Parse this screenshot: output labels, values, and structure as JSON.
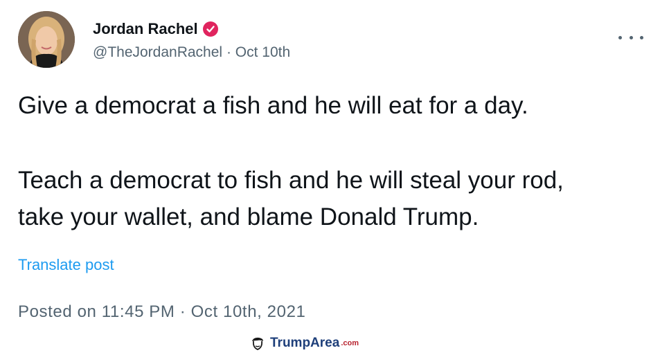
{
  "author": {
    "display_name": "Jordan Rachel",
    "handle": "@TheJordanRachel",
    "separator": "·",
    "date": "Oct 10th",
    "verified_icon": "verified-badge-icon",
    "verified_color": "#e0245e"
  },
  "menu": {
    "more_icon": "more-options-icon"
  },
  "tweet": {
    "line1": "Give a democrat a fish and he will eat for a day.",
    "line2": "Teach a democrat to fish and he will steal your rod,",
    "line3": "take your wallet, and blame Donald Trump."
  },
  "translate_label": "Translate post",
  "posted": "Posted on 11:45 PM · Oct 10th, 2021",
  "watermark": {
    "name": "TrumpArea",
    "tld": ".com",
    "icon": "trump-head-icon"
  },
  "colors": {
    "text": "#0f1419",
    "secondary": "#536471",
    "link": "#1d9bf0"
  }
}
